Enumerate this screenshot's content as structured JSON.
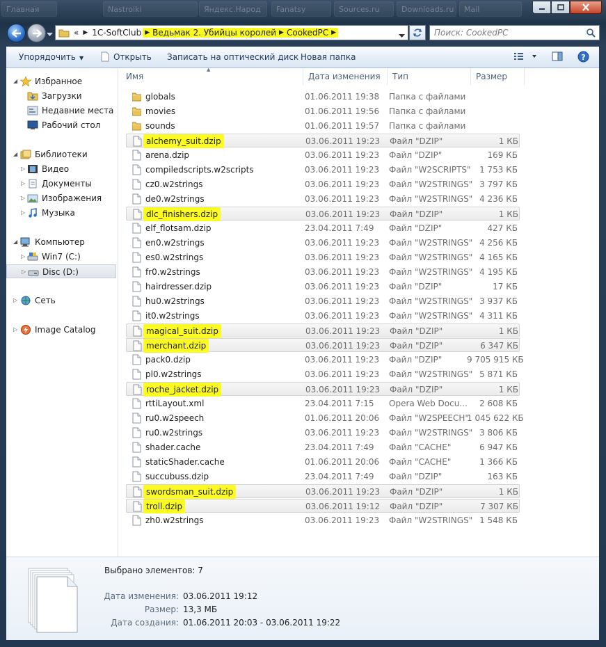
{
  "titlebar": {
    "ghost_tabs": [
      "Главная",
      "Nastroiki",
      "Яндекс.Народ",
      "Fanatsy",
      "Sources.ru",
      "Downloads.ru",
      "Mail"
    ],
    "accent": "#c7442a"
  },
  "address": {
    "prefix": "«",
    "segments": [
      "1C-SoftClub",
      "Ведьмак 2. Убийцы королей",
      "CookedPC"
    ],
    "highlight_color": "#fbfb21"
  },
  "search": {
    "placeholder": "Поиск: CookedPC"
  },
  "toolbar": {
    "organize": "Упорядочить",
    "open": "Открыть",
    "burn": "Записать на оптический диск",
    "new_folder": "Новая папка"
  },
  "nav": {
    "favorites": "Избранное",
    "downloads": "Загрузки",
    "recent": "Недавние места",
    "desktop": "Рабочий стол",
    "libraries": "Библиотеки",
    "video": "Видео",
    "documents": "Документы",
    "pictures": "Изображения",
    "music": "Музыка",
    "computer": "Компьютер",
    "win7": "Win7 (C:)",
    "disc": "Disc (D:)",
    "network": "Сеть",
    "image_catalog": "Image Catalog"
  },
  "columns": {
    "name": "Имя",
    "date": "Дата изменения",
    "type": "Тип",
    "size": "Размер"
  },
  "files": [
    {
      "name": "globals",
      "date": "01.06.2011 19:38",
      "type": "Папка с файлами",
      "size": "",
      "kind": "folder",
      "selected": false
    },
    {
      "name": "movies",
      "date": "01.06.2011 19:56",
      "type": "Папка с файлами",
      "size": "",
      "kind": "folder",
      "selected": false
    },
    {
      "name": "sounds",
      "date": "01.06.2011 19:57",
      "type": "Папка с файлами",
      "size": "",
      "kind": "folder",
      "selected": false
    },
    {
      "name": "alchemy_suit.dzip",
      "date": "03.06.2011 19:23",
      "type": "Файл \"DZIP\"",
      "size": "1 КБ",
      "kind": "file",
      "selected": true
    },
    {
      "name": "arena.dzip",
      "date": "03.06.2011 19:23",
      "type": "Файл \"DZIP\"",
      "size": "169 КБ",
      "kind": "file",
      "selected": false
    },
    {
      "name": "compiledscripts.w2scripts",
      "date": "03.06.2011 19:23",
      "type": "Файл \"W2SCRIPTS\"",
      "size": "1 753 КБ",
      "kind": "file",
      "selected": false
    },
    {
      "name": "cz0.w2strings",
      "date": "03.06.2011 19:23",
      "type": "Файл \"W2STRINGS\"",
      "size": "3 797 КБ",
      "kind": "file",
      "selected": false
    },
    {
      "name": "de0.w2strings",
      "date": "03.06.2011 19:23",
      "type": "Файл \"W2STRINGS\"",
      "size": "4 236 КБ",
      "kind": "file",
      "selected": false
    },
    {
      "name": "dlc_finishers.dzip",
      "date": "03.06.2011 19:23",
      "type": "Файл \"DZIP\"",
      "size": "1 КБ",
      "kind": "file",
      "selected": true
    },
    {
      "name": "elf_flotsam.dzip",
      "date": "23.04.2011 7:49",
      "type": "Файл \"DZIP\"",
      "size": "427 КБ",
      "kind": "file",
      "selected": false
    },
    {
      "name": "en0.w2strings",
      "date": "03.06.2011 19:23",
      "type": "Файл \"W2STRINGS\"",
      "size": "4 256 КБ",
      "kind": "file",
      "selected": false
    },
    {
      "name": "es0.w2strings",
      "date": "03.06.2011 19:23",
      "type": "Файл \"W2STRINGS\"",
      "size": "4 165 КБ",
      "kind": "file",
      "selected": false
    },
    {
      "name": "fr0.w2strings",
      "date": "03.06.2011 19:23",
      "type": "Файл \"W2STRINGS\"",
      "size": "4 195 КБ",
      "kind": "file",
      "selected": false
    },
    {
      "name": "hairdresser.dzip",
      "date": "03.06.2011 19:23",
      "type": "Файл \"DZIP\"",
      "size": "17 КБ",
      "kind": "file",
      "selected": false
    },
    {
      "name": "hu0.w2strings",
      "date": "03.06.2011 19:23",
      "type": "Файл \"W2STRINGS\"",
      "size": "3 937 КБ",
      "kind": "file",
      "selected": false
    },
    {
      "name": "it0.w2strings",
      "date": "03.06.2011 19:23",
      "type": "Файл \"W2STRINGS\"",
      "size": "4 311 КБ",
      "kind": "file",
      "selected": false
    },
    {
      "name": "magical_suit.dzip",
      "date": "03.06.2011 19:23",
      "type": "Файл \"DZIP\"",
      "size": "1 КБ",
      "kind": "file",
      "selected": true
    },
    {
      "name": "merchant.dzip",
      "date": "03.06.2011 19:23",
      "type": "Файл \"DZIP\"",
      "size": "6 347 КБ",
      "kind": "file",
      "selected": true
    },
    {
      "name": "pack0.dzip",
      "date": "03.06.2011 19:23",
      "type": "Файл \"DZIP\"",
      "size": "9 705 915 КБ",
      "kind": "file",
      "selected": false
    },
    {
      "name": "pl0.w2strings",
      "date": "03.06.2011 19:23",
      "type": "Файл \"W2STRINGS\"",
      "size": "5 871 КБ",
      "kind": "file",
      "selected": false
    },
    {
      "name": "roche_jacket.dzip",
      "date": "03.06.2011 19:23",
      "type": "Файл \"DZIP\"",
      "size": "1 КБ",
      "kind": "file",
      "selected": true
    },
    {
      "name": "rttiLayout.xml",
      "date": "23.04.2011 7:15",
      "type": "Opera Web Docu...",
      "size": "2 608 КБ",
      "kind": "file",
      "selected": false
    },
    {
      "name": "ru0.w2speech",
      "date": "01.06.2011 20:06",
      "type": "Файл \"W2SPEECH\"",
      "size": "1 045 622 КБ",
      "kind": "file",
      "selected": false
    },
    {
      "name": "ru0.w2strings",
      "date": "03.06.2011 19:23",
      "type": "Файл \"W2STRINGS\"",
      "size": "3 806 КБ",
      "kind": "file",
      "selected": false
    },
    {
      "name": "shader.cache",
      "date": "23.04.2011 7:49",
      "type": "Файл \"CACHE\"",
      "size": "6 947 КБ",
      "kind": "file",
      "selected": false
    },
    {
      "name": "staticShader.cache",
      "date": "01.06.2011 20:06",
      "type": "Файл \"CACHE\"",
      "size": "1 366 КБ",
      "kind": "file",
      "selected": false
    },
    {
      "name": "succubuss.dzip",
      "date": "23.04.2011 7:49",
      "type": "Файл \"DZIP\"",
      "size": "163 КБ",
      "kind": "file",
      "selected": false
    },
    {
      "name": "swordsman_suit.dzip",
      "date": "03.06.2011 19:23",
      "type": "Файл \"DZIP\"",
      "size": "1 КБ",
      "kind": "file",
      "selected": true
    },
    {
      "name": "troll.dzip",
      "date": "03.06.2011 19:12",
      "type": "Файл \"DZIP\"",
      "size": "7 307 КБ",
      "kind": "file",
      "selected": true
    },
    {
      "name": "zh0.w2strings",
      "date": "03.06.2011 19:23",
      "type": "Файл \"W2STRINGS\"",
      "size": "1 548 КБ",
      "kind": "file",
      "selected": false
    }
  ],
  "details": {
    "selected_count": "Выбрано элементов: 7",
    "modified_label": "Дата изменения:",
    "modified_value": "03.06.2011 19:12",
    "size_label": "Размер:",
    "size_value": "13,3 МБ",
    "created_label": "Дата создания:",
    "created_value": "01.06.2011 20:03 - 03.06.2011 19:22"
  }
}
